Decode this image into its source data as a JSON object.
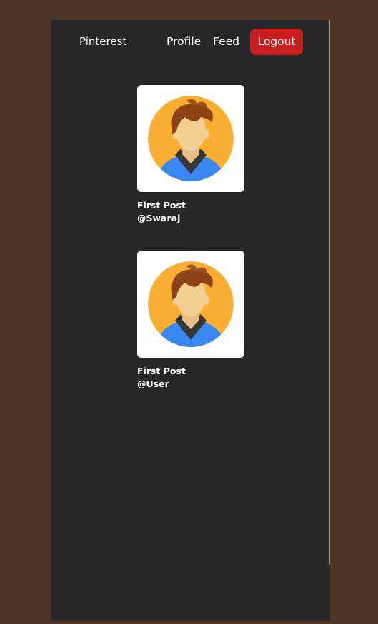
{
  "nav": {
    "brand": "Pinterest",
    "profile_label": "Profile",
    "feed_label": "Feed",
    "logout_label": "Logout"
  },
  "posts": [
    {
      "title": "First Post",
      "user": "@Swaraj",
      "image_icon": "avatar-icon"
    },
    {
      "title": "First Post",
      "user": "@User",
      "image_icon": "avatar-icon"
    }
  ],
  "colors": {
    "page_background": "#4e3527",
    "app_background": "#272729",
    "logout_button": "#c71e20",
    "text": "#ffffff"
  }
}
